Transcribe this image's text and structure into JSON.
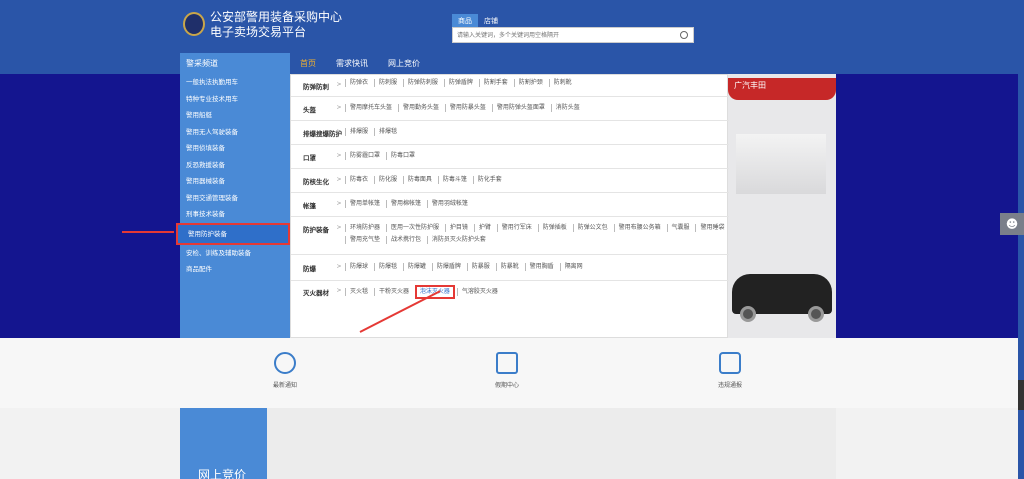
{
  "header": {
    "title_line1": "公安部警用装备采购中心",
    "title_line2": "电子卖场交易平台"
  },
  "search": {
    "tabs": [
      "商品",
      "店铺"
    ],
    "placeholder": "请输入关键词，多个关键词用空格隔开"
  },
  "nav": {
    "category_label": "警采频道",
    "items": [
      "首页",
      "需求快讯",
      "网上竞价"
    ]
  },
  "sidebar": {
    "items": [
      "一般执法执勤用车",
      "特种专业技术用车",
      "警用船艇",
      "警用无人驾驶装备",
      "警用侦填装备",
      "反恐救援装备",
      "警用器械装备",
      "警用交通管理装备",
      "刑事技术装备",
      "警用防护装备",
      "安检、训练及辅助装备",
      "商品配件"
    ],
    "selected_index": 9
  },
  "flyout": {
    "rows": [
      {
        "cat": "防弹防刺",
        "items": [
          "防弹衣",
          "防刺服",
          "防弹防刺服",
          "防弹盾牌",
          "防割手套",
          "防割护颈",
          "防刺靴"
        ]
      },
      {
        "cat": "头盔",
        "items": [
          "警用摩托车头盔",
          "警用勤务头盔",
          "警用防暴头盔",
          "警用防弹头盔面罩",
          "消防头盔"
        ]
      },
      {
        "cat": "排爆搜爆防护",
        "items": [
          "排爆服",
          "排爆毯"
        ]
      },
      {
        "cat": "口罩",
        "items": [
          "防雾霾口罩",
          "防毒口罩"
        ]
      },
      {
        "cat": "防核生化",
        "items": [
          "防毒衣",
          "防化服",
          "防毒面具",
          "防毒斗篷",
          "防化手套"
        ]
      },
      {
        "cat": "帐篷",
        "items": [
          "警用单帐篷",
          "警用棉帐篷",
          "警用羽绒帐篷"
        ]
      },
      {
        "cat": "防护装备",
        "items": [
          "环境防护器",
          "医用一次性防护服",
          "护目镜",
          "护臂",
          "警用行军床",
          "防弹插板",
          "防弹公文包",
          "警用布腰公务箱",
          "气囊服",
          "警用睡袋",
          "警用充气垫",
          "战术携行包",
          "消防员灭火防护头套"
        ]
      },
      {
        "cat": "防爆",
        "items": [
          "防爆球",
          "防爆毯",
          "防爆罐",
          "防爆盾牌",
          "防暴服",
          "防暴靴",
          "警用胸盾",
          "隔离网"
        ]
      },
      {
        "cat": "灭火器材",
        "items": [
          "灭火毯",
          "干粉灭火器",
          "泡沫灭火器",
          "气溶胶灭火器"
        ]
      }
    ],
    "highlight": "泡沫灭火器"
  },
  "car_ad": {
    "brand": "广汽丰田"
  },
  "features": [
    "最新通知",
    "假期中心",
    "违规通报"
  ],
  "bottom": {
    "label": "网上竞价"
  },
  "colors": {
    "header": "#2a55a8",
    "banner": "#14158f",
    "sidebar": "#4a8ad6",
    "highlight_border": "#e53935"
  }
}
